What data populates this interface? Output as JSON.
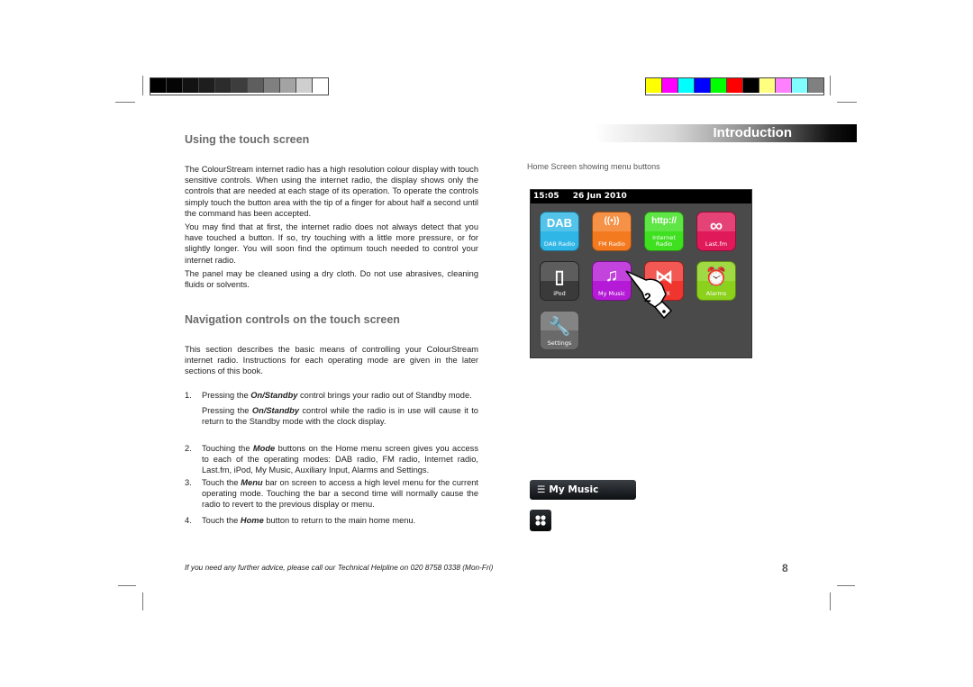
{
  "calibration": {
    "grayscale": [
      "#000000",
      "#050505",
      "#121212",
      "#1e1e1e",
      "#2c2c2c",
      "#3d3d3d",
      "#5e5e5e",
      "#808080",
      "#a3a3a3",
      "#cfcfcf",
      "#ffffff"
    ],
    "color": [
      "#ffff00",
      "#ff00ff",
      "#00ffff",
      "#0000ff",
      "#00ff00",
      "#ff0000",
      "#000000",
      "#ffff80",
      "#ff80ff",
      "#80ffff",
      "#808080"
    ]
  },
  "header": {
    "banner": "Introduction"
  },
  "left": {
    "section1_title": "Using the touch screen",
    "p1": "The ColourStream internet radio has a high resolution colour display with touch sensitive controls. When using the internet radio, the display shows only the controls that are needed at each stage of its operation. To operate the controls simply touch the button area with the tip of a finger for about half a second until the command has been accepted.",
    "p2": "You may find that at first, the internet radio does not always detect that you have touched a button. If so, try touching with a little more pressure, or for slightly longer. You will soon find the optimum touch needed to control your internet radio.",
    "p3": "The panel may be cleaned using a dry cloth. Do not use abrasives, cleaning fluids or solvents.",
    "section2_title": "Navigation controls on the touch screen",
    "p4": "This section describes the basic means of controlling your ColourStream internet radio. Instructions for each operating mode are given in the later sections of this book.",
    "list": [
      {
        "num": "1.",
        "pre": "Pressing the ",
        "em": "On/Standby",
        "post": " control brings your radio out of Standby mode.",
        "sub_pre": "Pressing the ",
        "sub_em": "On/Standby",
        "sub_post": " control while the radio is in use will cause it to return to the Standby mode with the clock display."
      },
      {
        "num": "2.",
        "pre": "Touching the ",
        "em": "Mode",
        "post": " buttons on the Home menu screen gives you access to each of the operating modes: DAB radio, FM radio, Internet radio, Last.fm, iPod, My Music, Auxiliary Input, Alarms and Settings."
      },
      {
        "num": "3.",
        "pre": "Touch the ",
        "em": "Menu",
        "post": " bar on screen to access a high level menu for the current operating mode. Touching the bar a second time will normally cause the radio to revert to the previous display or menu."
      },
      {
        "num": "4.",
        "pre": "Touch the ",
        "em": "Home",
        "post": " button to return to the main home menu."
      }
    ]
  },
  "right": {
    "caption": "Home Screen showing menu buttons",
    "screen": {
      "time": "15:05",
      "date": "26 Jun 2010",
      "tiles": [
        {
          "label": "DAB Radio",
          "icon": "dab-logo",
          "glyph": "DAB",
          "color": "#2fb6e6"
        },
        {
          "label": "FM Radio",
          "icon": "antenna-icon",
          "glyph": "((•))",
          "color": "#f47a1f"
        },
        {
          "label": "Internet Radio",
          "icon": "http-icon",
          "glyph": "http://",
          "color": "#3ee01f"
        },
        {
          "label": "Last.fm",
          "icon": "lastfm-icon",
          "glyph": "∞",
          "color": "#e0195a"
        },
        {
          "label": "iPod",
          "icon": "ipod-icon",
          "glyph": "▯",
          "color": "#3a3a3a"
        },
        {
          "label": "My Music",
          "icon": "music-note-icon",
          "glyph": "♫",
          "color": "#b51bd6"
        },
        {
          "label": "AUX",
          "icon": "aux-icon",
          "glyph": "⋈",
          "color": "#f0352f"
        },
        {
          "label": "Alarms",
          "icon": "alarm-clock-icon",
          "glyph": "⏰",
          "color": "#8cd11b"
        },
        {
          "label": "Settings",
          "icon": "wrench-icon",
          "glyph": "🔧",
          "color": "#6a6a6a"
        }
      ],
      "pointer_callout": "2"
    },
    "menu_bar_label": "My Music"
  },
  "footer": {
    "helpline": "If you need any further advice, please call our Technical Helpline on 020 8758 0338 (Mon-Fri)",
    "page_number": "8"
  }
}
